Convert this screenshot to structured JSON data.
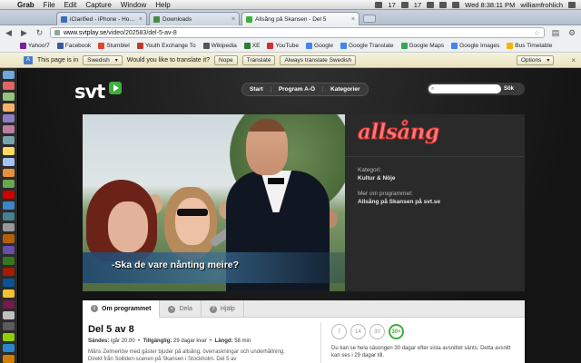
{
  "menubar": {
    "apple": "",
    "items": [
      "Grab",
      "File",
      "Edit",
      "Capture",
      "Window",
      "Help"
    ],
    "clock": "Wed 8:38:11 PM",
    "user": "williamfrohlich",
    "badges": [
      "17",
      "17"
    ]
  },
  "tabs": [
    {
      "label": "iClarified - iPhone - How to",
      "favicon_color": "#3b6fb6"
    },
    {
      "label": "Downloads",
      "favicon_color": "#4a8a4a"
    },
    {
      "label": "Allsång på Skansen - Del 5",
      "favicon_color": "#3dae3d"
    }
  ],
  "toolbar": {
    "url_host": "www.svtplay.se",
    "url_path": "/video/202583/del-5-av-8"
  },
  "bookmarks": [
    {
      "label": "Yahoo!7",
      "color": "#7b1fa2"
    },
    {
      "label": "Facebook",
      "color": "#3b5998"
    },
    {
      "label": "StumbleI",
      "color": "#e2452a"
    },
    {
      "label": "Youth Exchange To",
      "color": "#c0392b"
    },
    {
      "label": "Wikipedia",
      "color": "#555"
    },
    {
      "label": "XE",
      "color": "#2e7d32"
    },
    {
      "label": "YouTube",
      "color": "#d32f2f"
    },
    {
      "label": "Google",
      "color": "#4285f4"
    },
    {
      "label": "Google Translate",
      "color": "#4285f4"
    },
    {
      "label": "Google Maps",
      "color": "#34a853"
    },
    {
      "label": "Google Images",
      "color": "#4285f4"
    },
    {
      "label": "Bus Timetable",
      "color": "#f4b400"
    }
  ],
  "translate_bar": {
    "prefix": "This page is in",
    "language": "Swedish",
    "question": "Would you like to translate it?",
    "nope": "Nope",
    "translate": "Translate",
    "always": "Always translate Swedish",
    "options": "Options"
  },
  "dock_colors": [
    "#6fa8dc",
    "#e06666",
    "#93c47d",
    "#f6b26b",
    "#8e7cc3",
    "#c27ba0",
    "#76a5af",
    "#ffd966",
    "#a4c2f4",
    "#e69138",
    "#6aa84f",
    "#cc0000",
    "#3d85c6",
    "#45818e",
    "#999999",
    "#b45f06",
    "#674ea7",
    "#38761d",
    "#a61c00",
    "#0b5394",
    "#f1c232",
    "#741b47",
    "#c0c0c0",
    "#5b5b5b",
    "#8fce00",
    "#2986cc",
    "#ce7e00"
  ],
  "site": {
    "logo": "svt",
    "nav": [
      "Start",
      "Program A-Ö",
      "Kategorier"
    ],
    "search_button": "Sök"
  },
  "player": {
    "subtitle": "-Ska de vare nånting meire?"
  },
  "side": {
    "program_logo": "allsång",
    "category_label": "Kategori:",
    "category_value": "Kultur & Nöje",
    "more_label": "Mer om programmet:",
    "more_value": "Allsång på Skansen på svt.se"
  },
  "info": {
    "tabs": [
      {
        "label": "Om programmet",
        "icon": "i"
      },
      {
        "label": "Dela",
        "icon": "<"
      },
      {
        "label": "Hjälp",
        "icon": "?"
      }
    ],
    "title": "Del 5 av 8",
    "sands_label": "Sändes:",
    "sands_value": "igår 20.00",
    "tillganglig_label": "Tillgänglig:",
    "tillganglig_value": "29 dagar kvar",
    "langd_label": "Längd:",
    "langd_value": "58 min",
    "description": "Måns Zelmerlöw med gäster bjuder på allsång, överraskningar och underhållning. Direkt från Solliden-scenen på Skansen i Stockholm. Del 5 av",
    "ages": [
      "7",
      "14",
      "30",
      "30+"
    ],
    "age_active_index": 3,
    "availability": "Du kan se hela säsongen 30 dagar efter sista avsnittet sänts. Detta avsnitt kan ses i 29 dagar till."
  }
}
